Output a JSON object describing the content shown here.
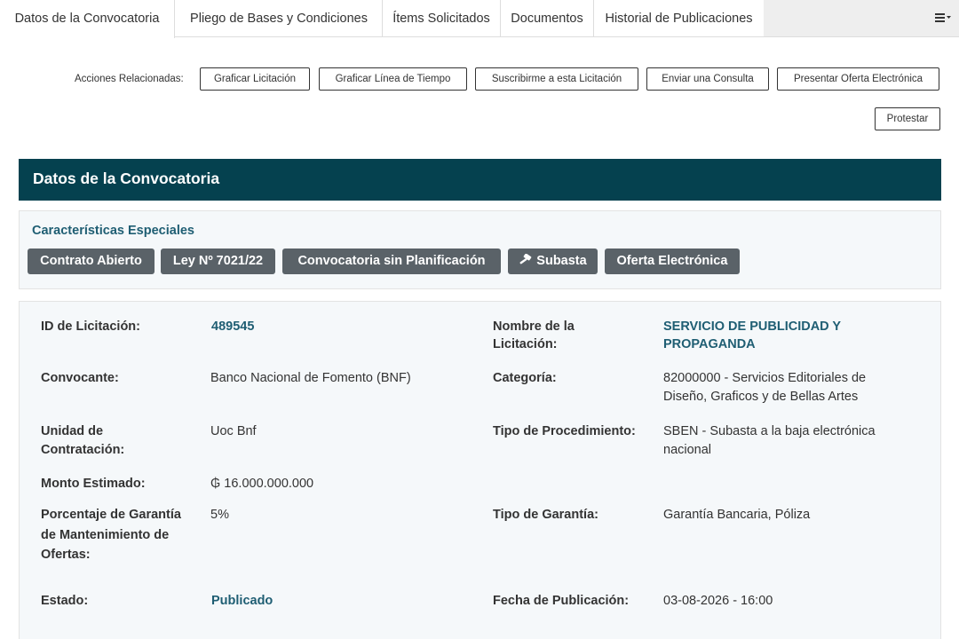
{
  "tabs": {
    "datos": "Datos de la Convocatoria",
    "pliego": "Pliego de Bases y Condiciones",
    "items": "Ítems Solicitados",
    "documentos": "Documentos",
    "historial": "Historial de Publicaciones",
    "menu_icon": "hamburger-menu-icon"
  },
  "actions": {
    "label": "Acciones Relacionadas:",
    "graficar_licitacion": "Graficar Licitación",
    "graficar_linea": "Graficar Línea de Tiempo",
    "suscribirme": "Suscribirme a esta Licitación",
    "consulta": "Enviar una Consulta",
    "oferta": "Presentar Oferta Electrónica",
    "protestar": "Protestar"
  },
  "panel": {
    "title": "Datos de la Convocatoria"
  },
  "special": {
    "title": "Características Especiales",
    "tags": {
      "contrato": "Contrato Abierto",
      "ley": "Ley Nº 7021/22",
      "sin_planificacion": "Convocatoria sin Planificación",
      "subasta": "Subasta",
      "subasta_icon": "gavel-icon",
      "oferta": "Oferta Electrónica"
    }
  },
  "details": {
    "id_label": "ID de Licitación:",
    "id_value": "489545",
    "nombre_label_1": "Nombre de la",
    "nombre_label_2": "Licitación:",
    "nombre_value_1": "SERVICIO DE PUBLICIDAD Y",
    "nombre_value_2": "PROPAGANDA",
    "convocante_label": "Convocante:",
    "convocante_value": "Banco Nacional de Fomento (BNF)",
    "categoria_label": "Categoría:",
    "categoria_value_1": "82000000 - Servicios Editoriales de",
    "categoria_value_2": "Diseño, Graficos y de Bellas Artes",
    "unidad_label_1": "Unidad de",
    "unidad_label_2": "Contratación:",
    "unidad_value": "Uoc Bnf",
    "tipo_proc_label": "Tipo de Procedimiento:",
    "tipo_proc_value_1": "SBEN - Subasta a la baja electrónica",
    "tipo_proc_value_2": "nacional",
    "monto_label": "Monto Estimado:",
    "monto_value": "₲ 16.000.000.000",
    "garantia_label_1": "Porcentaje de Garantía",
    "garantia_label_2": "de Mantenimiento de",
    "garantia_label_3": "Ofertas:",
    "garantia_value": "5%",
    "tipo_garantia_label": "Tipo de Garantía:",
    "tipo_garantia_value": "Garantía Bancaria, Póliza",
    "estado_label": "Estado:",
    "estado_value": "Publicado",
    "fecha_label": "Fecha de Publicación:",
    "fecha_value": "03-08-2026 - 16:00"
  },
  "colors": {
    "heading_bg": "#05414f",
    "link": "#1f5e73",
    "tag_bg": "#5a6268",
    "well_bg": "#f5f8fa"
  }
}
